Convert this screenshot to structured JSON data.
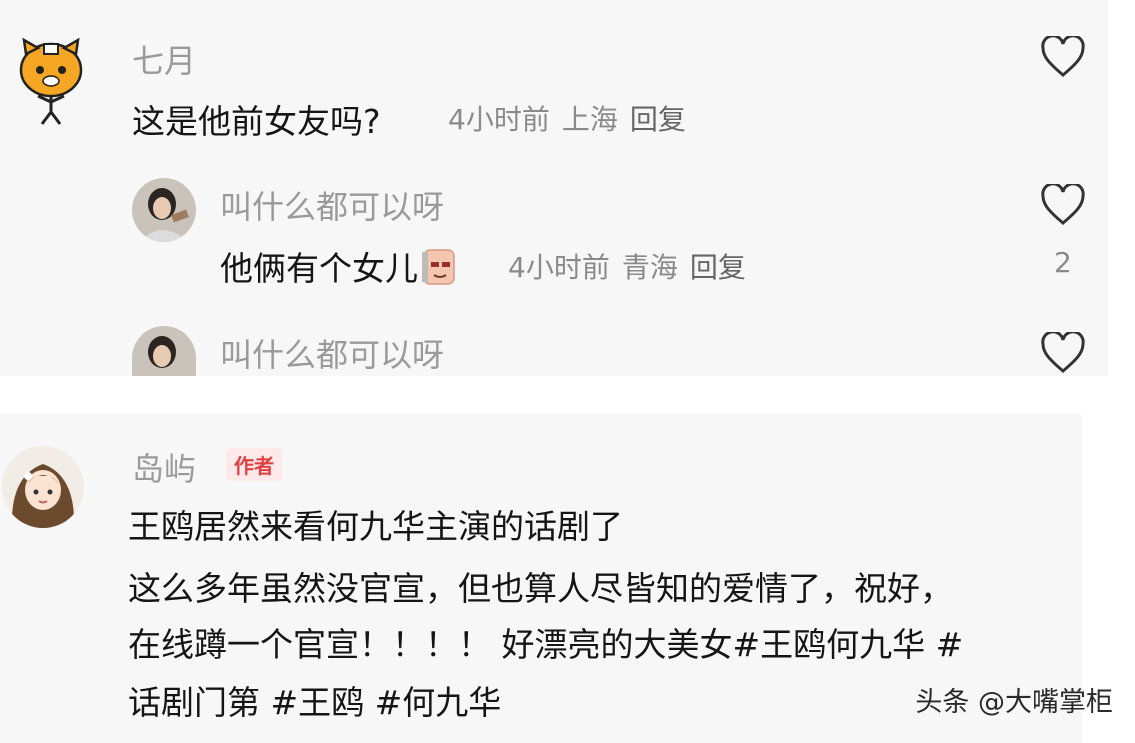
{
  "comments": [
    {
      "user": "七月",
      "text": "这是他前女友吗?",
      "time": "4小时前",
      "location": "上海",
      "reply_label": "回复"
    },
    {
      "user": "叫什么都可以呀",
      "text": "他俩有个女儿",
      "time": "4小时前",
      "location": "青海",
      "reply_label": "回复",
      "like_count": "2"
    },
    {
      "user": "叫什么都可以呀"
    }
  ],
  "post": {
    "user": "岛屿",
    "badge": "作者",
    "lines": [
      "王鸥居然来看何九华主演的话剧了",
      "这么多年虽然没官宣，但也算人尽皆知的爱情了，祝好，",
      "在线蹲一个官宣！！！！ 好漂亮的大美女#王鸥何九华 #",
      "话剧门第 #王鸥 #何九华"
    ]
  },
  "watermark": "头条 @大嘴掌柜",
  "icons": {
    "like": "heart-outline-icon",
    "emoji": "sticker-emoji-icon"
  }
}
